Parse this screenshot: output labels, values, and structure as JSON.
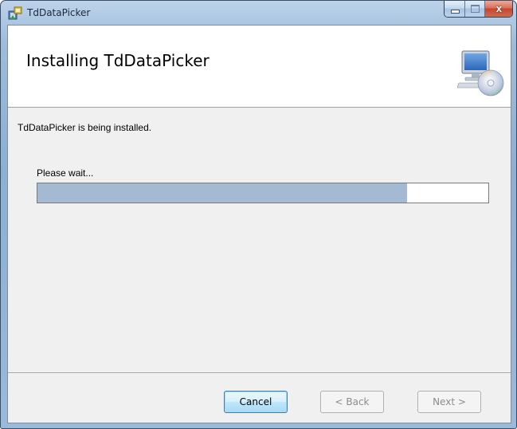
{
  "window": {
    "title": "TdDataPicker",
    "close_glyph": "x",
    "icons": {
      "app": "installer-package-icon",
      "minimize": "minimize-icon",
      "maximize": "maximize-icon",
      "close": "close-icon"
    }
  },
  "header": {
    "title": "Installing TdDataPicker",
    "icon": "computer-cd-icon"
  },
  "body": {
    "status_text": "TdDataPicker is being installed.",
    "wait_text": "Please wait...",
    "progress_percent": 82
  },
  "buttons": {
    "cancel": "Cancel",
    "back": "< Back",
    "next": "Next >"
  },
  "colors": {
    "progress_fill": "#a4bad3",
    "client_bg": "#f0f0f0",
    "header_bg": "#ffffff",
    "close_button": "#c2462c"
  }
}
